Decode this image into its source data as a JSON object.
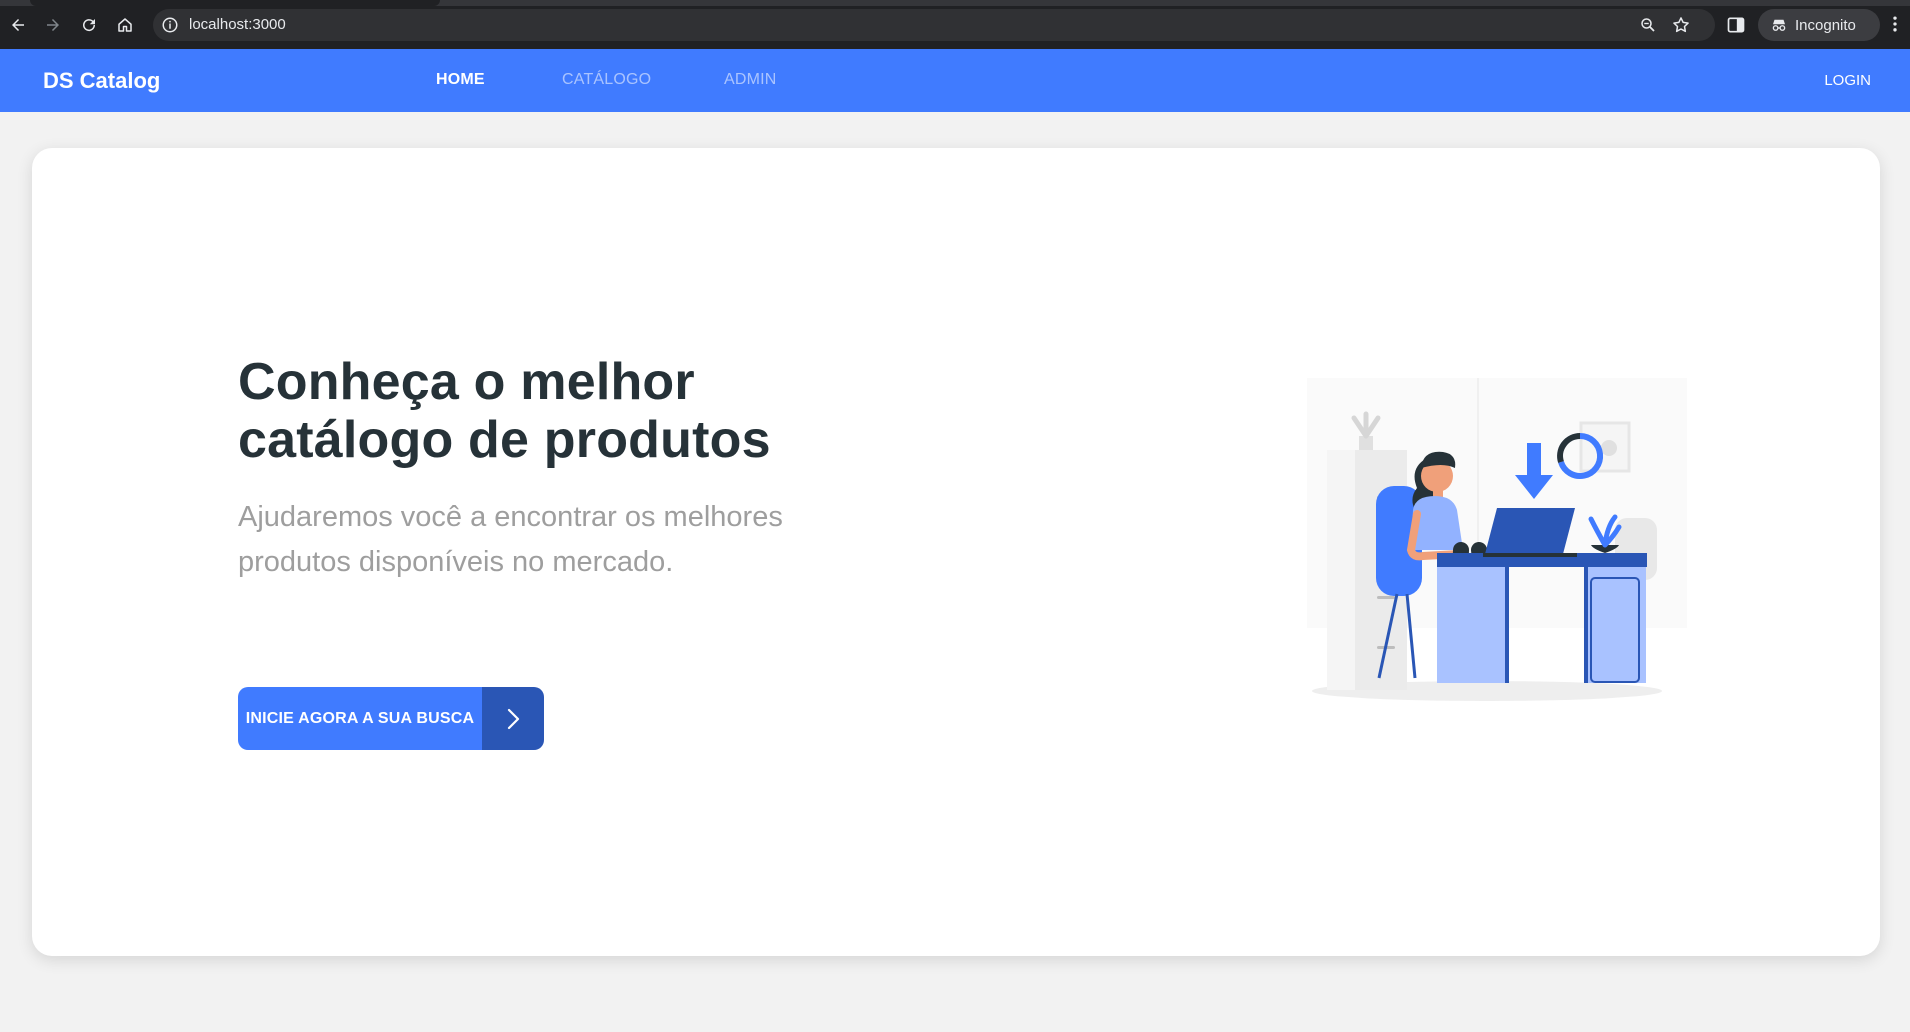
{
  "browser": {
    "url": "localhost:3000",
    "mode_label": "Incognito",
    "icons": [
      "back-icon",
      "forward-icon",
      "reload-icon",
      "home-icon",
      "site-info-icon",
      "zoom-icon",
      "bookmark-star-icon",
      "side-panel-icon",
      "incognito-icon",
      "kebab-menu-icon"
    ]
  },
  "navbar": {
    "brand": "DS Catalog",
    "links": [
      {
        "label": "HOME",
        "active": true
      },
      {
        "label": "CATÁLOGO",
        "active": false
      },
      {
        "label": "ADMIN",
        "active": false
      }
    ],
    "login": "LOGIN",
    "color": "#407bff"
  },
  "hero": {
    "title_line1": "Conheça o melhor",
    "title_line2": "catálogo de produtos",
    "subtitle_line1": "Ajudaremos você a encontrar os melhores",
    "subtitle_line2": "produtos disponíveis no mercado.",
    "cta_label": "INICIE AGORA A SUA BUSCA",
    "cta_icon": "chevron-right-icon"
  },
  "colors": {
    "primary": "#407bff",
    "primary_dark": "#2a56b5",
    "title": "#263238",
    "subtitle": "#9e9e9e",
    "page_bg": "#f2f2f2"
  }
}
